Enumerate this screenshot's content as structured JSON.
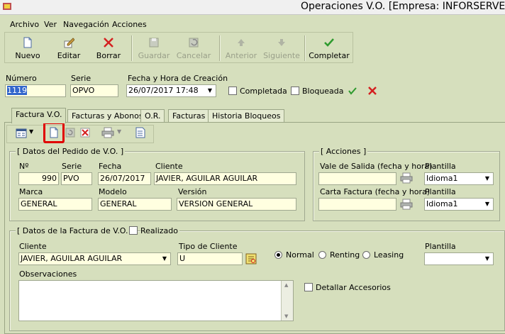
{
  "window": {
    "title": "Operaciones V.O. [Empresa: INFORSERVEIS I"
  },
  "menu": [
    "Archivo",
    "Ver",
    "Navegación",
    "Acciones"
  ],
  "toolbar": {
    "nuevo": "Nuevo",
    "editar": "Editar",
    "borrar": "Borrar",
    "guardar": "Guardar",
    "cancelar": "Cancelar",
    "anterior": "Anterior",
    "siguiente": "Siguiente",
    "completar": "Completar"
  },
  "header": {
    "numero_label": "Número",
    "numero_value": "1119",
    "serie_label": "Serie",
    "serie_value": "OPVO",
    "fecha_label": "Fecha y Hora de Creación",
    "fecha_value": "26/07/2017 17:48",
    "completada_label": "Completada",
    "bloqueada_label": "Bloqueada"
  },
  "tabs": [
    "Factura V.O.",
    "Facturas y Abonos",
    "O.R.",
    "Facturas",
    "Historia Bloqueos"
  ],
  "pedido": {
    "title": "[ Datos del Pedido de V.O. ]",
    "n_label": "Nº",
    "n_value": "990",
    "serie_label": "Serie",
    "serie_value": "PVO",
    "fecha_label": "Fecha",
    "fecha_value": "26/07/2017",
    "cliente_label": "Cliente",
    "cliente_value": "JAVIER, AGUILAR AGUILAR",
    "marca_label": "Marca",
    "marca_value": "GENERAL",
    "modelo_label": "Modelo",
    "modelo_value": "GENERAL",
    "version_label": "Versión",
    "version_value": "VERSION GENERAL"
  },
  "acciones": {
    "title": "[ Acciones ]",
    "vale_label": "Vale de Salida (fecha y hora)",
    "carta_label": "Carta Factura (fecha y hora)",
    "plantilla_label": "Plantilla",
    "plantilla1_value": "Idioma1",
    "plantilla2_value": "Idioma1"
  },
  "factura": {
    "title": "[ Datos de la Factura de V.O. ]",
    "realizado_label": "Realizado",
    "cliente_label": "Cliente",
    "cliente_value": "JAVIER, AGUILAR AGUILAR",
    "tipo_label": "Tipo de Cliente",
    "tipo_value": "U",
    "normal_label": "Normal",
    "renting_label": "Renting",
    "leasing_label": "Leasing",
    "plantilla_label": "Plantilla",
    "observaciones_label": "Observaciones",
    "detallar_label": "Detallar Accesorios"
  },
  "colors": {
    "accent_green": "#2e9a2e",
    "accent_red": "#d42020",
    "highlight_red": "#e00000",
    "field_bg": "#ffffe0",
    "window_bg": "#d6dfbd"
  }
}
